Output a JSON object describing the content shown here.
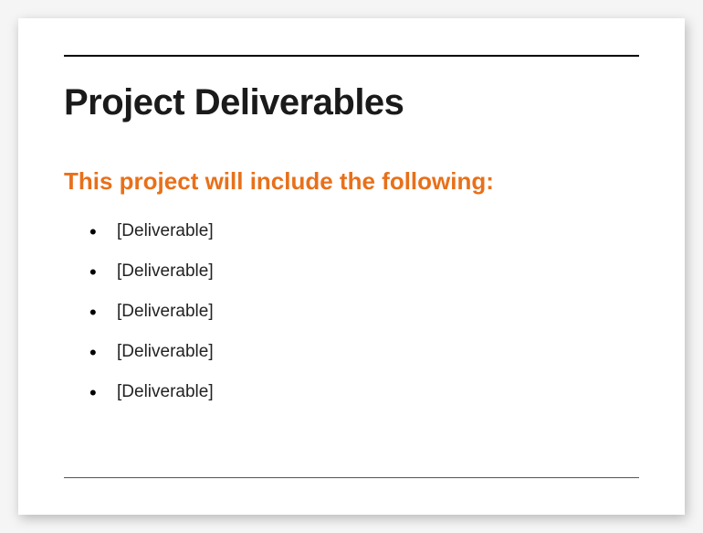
{
  "heading": "Project Deliverables",
  "subheading": "This project will include the following:",
  "items": [
    "[Deliverable]",
    "[Deliverable]",
    "[Deliverable]",
    "[Deliverable]",
    "[Deliverable]"
  ]
}
